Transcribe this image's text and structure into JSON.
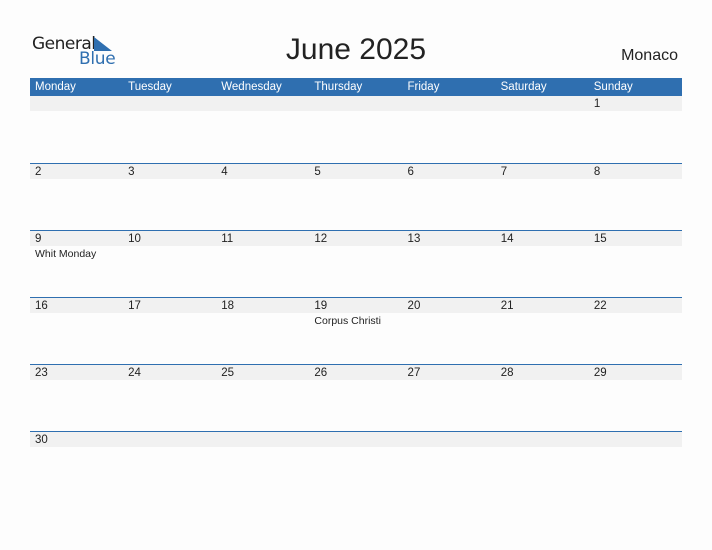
{
  "logo": {
    "line1": "General",
    "line2": "Blue"
  },
  "title": "June 2025",
  "country": "Monaco",
  "colors": {
    "accent": "#2f6fb0",
    "band": "#f1f1f1"
  },
  "weekdays": [
    "Monday",
    "Tuesday",
    "Wednesday",
    "Thursday",
    "Friday",
    "Saturday",
    "Sunday"
  ],
  "weeks": [
    [
      {
        "d": ""
      },
      {
        "d": ""
      },
      {
        "d": ""
      },
      {
        "d": ""
      },
      {
        "d": ""
      },
      {
        "d": ""
      },
      {
        "d": "1"
      }
    ],
    [
      {
        "d": "2"
      },
      {
        "d": "3"
      },
      {
        "d": "4"
      },
      {
        "d": "5"
      },
      {
        "d": "6"
      },
      {
        "d": "7"
      },
      {
        "d": "8"
      }
    ],
    [
      {
        "d": "9",
        "h": "Whit Monday"
      },
      {
        "d": "10"
      },
      {
        "d": "11"
      },
      {
        "d": "12"
      },
      {
        "d": "13"
      },
      {
        "d": "14"
      },
      {
        "d": "15"
      }
    ],
    [
      {
        "d": "16"
      },
      {
        "d": "17"
      },
      {
        "d": "18"
      },
      {
        "d": "19",
        "h": "Corpus Christi"
      },
      {
        "d": "20"
      },
      {
        "d": "21"
      },
      {
        "d": "22"
      }
    ],
    [
      {
        "d": "23"
      },
      {
        "d": "24"
      },
      {
        "d": "25"
      },
      {
        "d": "26"
      },
      {
        "d": "27"
      },
      {
        "d": "28"
      },
      {
        "d": "29"
      }
    ],
    [
      {
        "d": "30"
      },
      {
        "d": ""
      },
      {
        "d": ""
      },
      {
        "d": ""
      },
      {
        "d": ""
      },
      {
        "d": ""
      },
      {
        "d": ""
      }
    ]
  ]
}
